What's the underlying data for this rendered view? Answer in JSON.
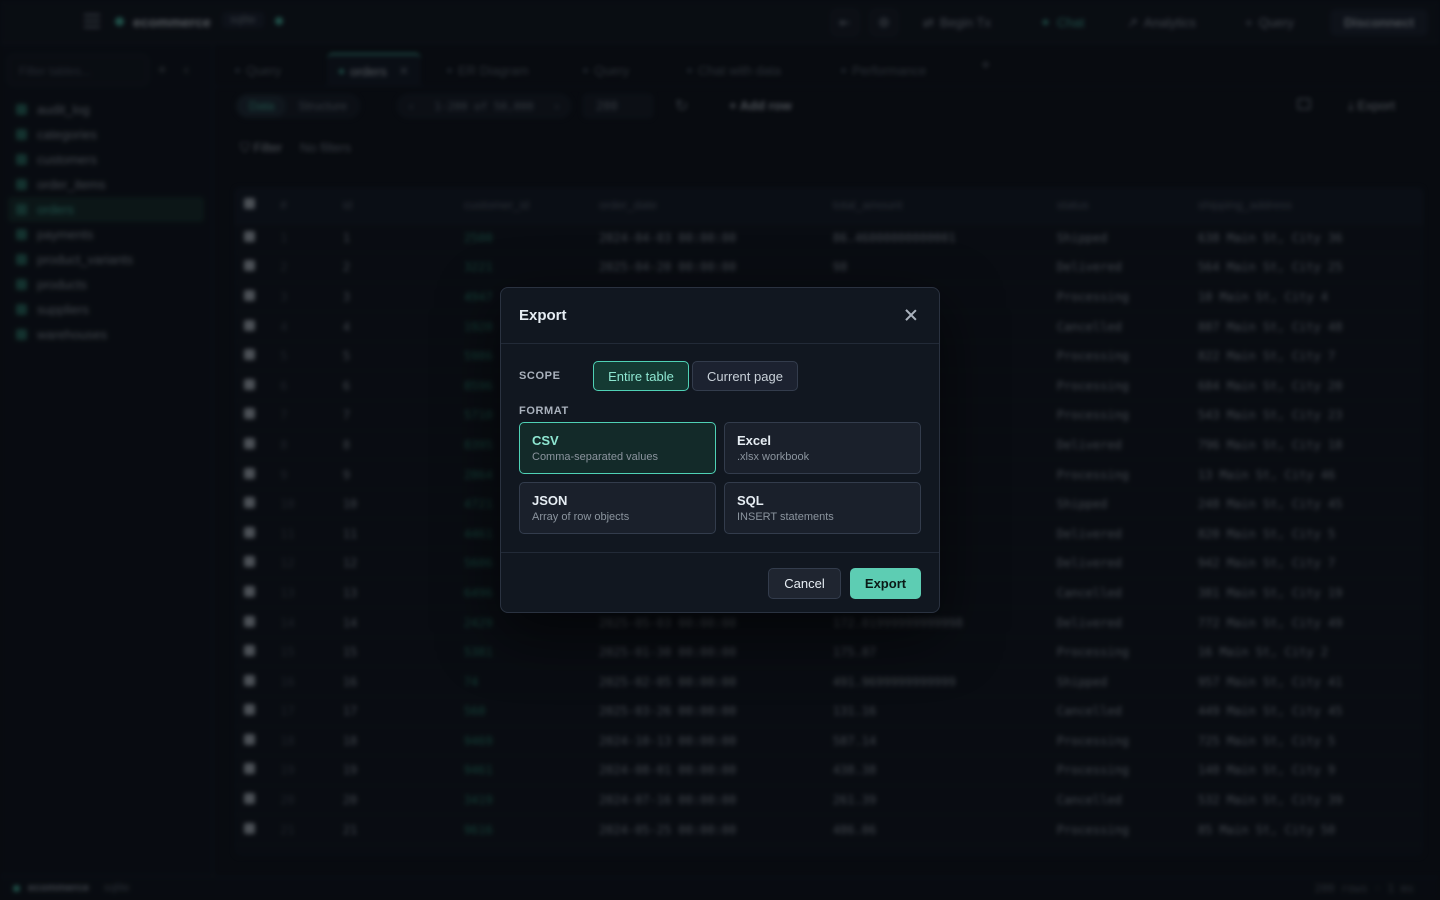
{
  "topbar": {
    "connection_name": "ecommerce",
    "driver": "sqlite",
    "begin_tx": "Begin Tx",
    "chat": "Chat",
    "analytics": "Analytics",
    "query": "Query",
    "disconnect": "Disconnect"
  },
  "sidebar": {
    "filter_placeholder": "Filter tables...",
    "tables": [
      "audit_log",
      "categories",
      "customers",
      "order_items",
      "orders",
      "payments",
      "product_variants",
      "products",
      "suppliers",
      "warehouses"
    ],
    "active_table": "orders"
  },
  "tabs": [
    {
      "label": "Query"
    },
    {
      "label": "orders",
      "active": true
    },
    {
      "label": "ER Diagram"
    },
    {
      "label": "Query"
    },
    {
      "label": "Chat with data"
    },
    {
      "label": "Performance"
    }
  ],
  "toolbar": {
    "view_data": "Data",
    "view_structure": "Structure",
    "range": "1-200 of 50,000",
    "page_size": "200",
    "add_row": "Add row",
    "export": "Export"
  },
  "filterbar": {
    "label": "Filter",
    "empty": "No filters"
  },
  "grid": {
    "columns": [
      "#",
      "id",
      "customer_id",
      "order_date",
      "total_amount",
      "status",
      "shipping_address"
    ],
    "rows": [
      [
        "1",
        "1",
        "2500",
        "2024-04-03 00:00:00",
        "86.46000000000001",
        "Shipped",
        "638 Main St, City 36"
      ],
      [
        "2",
        "2",
        "3221",
        "2025-04-20 00:00:00",
        "98",
        "Delivered",
        "564 Main St, City 25"
      ],
      [
        "3",
        "3",
        "4947",
        "",
        "",
        "Processing",
        "10 Main St, City 4"
      ],
      [
        "4",
        "4",
        "1920",
        "",
        "",
        "Cancelled",
        "887 Main St, City 48"
      ],
      [
        "5",
        "5",
        "5986",
        "",
        "",
        "Processing",
        "822 Main St, City 7"
      ],
      [
        "6",
        "6",
        "8596",
        "",
        "",
        "Processing",
        "684 Main St, City 20"
      ],
      [
        "7",
        "7",
        "5710",
        "",
        "",
        "Processing",
        "543 Main St, City 23"
      ],
      [
        "8",
        "8",
        "8395",
        "",
        "",
        "Delivered",
        "796 Main St, City 18"
      ],
      [
        "9",
        "9",
        "2864",
        "",
        "",
        "Processing",
        "13 Main St, City 46"
      ],
      [
        "10",
        "10",
        "4721",
        "",
        "",
        "Shipped",
        "248 Main St, City 45"
      ],
      [
        "11",
        "11",
        "4461",
        "",
        "",
        "Delivered",
        "820 Main St, City 5"
      ],
      [
        "12",
        "12",
        "5606",
        "",
        "",
        "Delivered",
        "942 Main St, City 7"
      ],
      [
        "13",
        "13",
        "6496",
        "",
        "",
        "Cancelled",
        "381 Main St, City 19"
      ],
      [
        "14",
        "14",
        "2429",
        "2025-05-03 00:00:00",
        "172.01999999999998",
        "Delivered",
        "772 Main St, City 49"
      ],
      [
        "15",
        "15",
        "5381",
        "2025-01-30 00:00:00",
        "175.87",
        "Processing",
        "16 Main St, City 2"
      ],
      [
        "16",
        "16",
        "74",
        "2025-02-05 00:00:00",
        "491.9699999999999",
        "Shipped",
        "957 Main St, City 41"
      ],
      [
        "17",
        "17",
        "560",
        "2025-03-26 00:00:00",
        "131.16",
        "Cancelled",
        "449 Main St, City 45"
      ],
      [
        "18",
        "18",
        "9469",
        "2024-10-13 00:00:00",
        "587.14",
        "Processing",
        "725 Main St, City 5"
      ],
      [
        "19",
        "19",
        "9461",
        "2024-08-01 00:00:00",
        "438.38",
        "Processing",
        "140 Main St, City 9"
      ],
      [
        "20",
        "20",
        "3419",
        "2024-07-16 00:00:00",
        "261.39",
        "Cancelled",
        "532 Main St, City 39"
      ],
      [
        "21",
        "21",
        "9616",
        "2024-05-25 00:00:00",
        "486.06",
        "Processing",
        "85 Main St, City 50"
      ]
    ]
  },
  "statusbar": {
    "connection": "ecommerce",
    "driver": "sqlite",
    "summary": "200 rows · 1 ms"
  },
  "modal": {
    "title": "Export",
    "scope_label": "SCOPE",
    "scope_options": [
      "Entire table",
      "Current page"
    ],
    "scope_selected": "Entire table",
    "format_label": "FORMAT",
    "formats": [
      {
        "name": "CSV",
        "desc": "Comma-separated values",
        "selected": true
      },
      {
        "name": "Excel",
        "desc": ".xlsx workbook"
      },
      {
        "name": "JSON",
        "desc": "Array of row objects"
      },
      {
        "name": "SQL",
        "desc": "INSERT statements"
      }
    ],
    "cancel": "Cancel",
    "export": "Export"
  },
  "colors": {
    "accent": "#4fd1b5",
    "background": "#0b0e14",
    "modal_bg": "#111720"
  }
}
